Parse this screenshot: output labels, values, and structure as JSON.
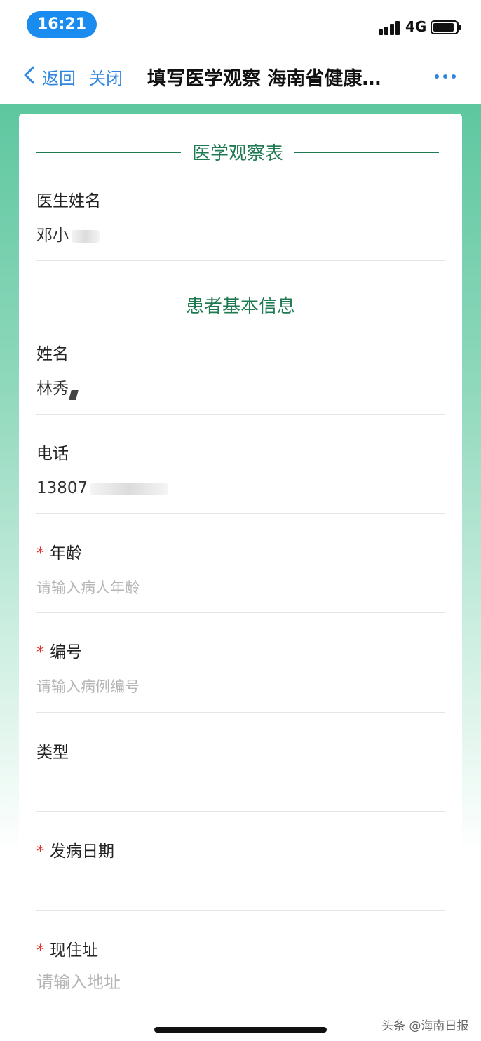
{
  "status_bar": {
    "time": "16:21",
    "network": "4G"
  },
  "nav": {
    "back_label": "返回",
    "close_label": "关闭",
    "title": "填写医学观察 海南省健康…"
  },
  "form": {
    "section_title": "医学观察表",
    "doctor_name": {
      "label": "医生姓名",
      "value": "邓小"
    },
    "patient_section_title": "患者基本信息",
    "name": {
      "label": "姓名",
      "value": "林秀"
    },
    "phone": {
      "label": "电话",
      "value": "13807"
    },
    "age": {
      "label": "年龄",
      "required_mark": "*",
      "placeholder": "请输入病人年龄"
    },
    "case_number": {
      "label": "编号",
      "required_mark": "*",
      "placeholder": "请输入病例编号"
    },
    "type": {
      "label": "类型",
      "value": ""
    },
    "onset_date": {
      "label": "发病日期",
      "required_mark": "*",
      "value": ""
    },
    "address": {
      "label": "现住址",
      "required_mark": "*",
      "placeholder": "请输入地址"
    }
  },
  "watermark": "头条 @海南日报",
  "colors": {
    "accent_blue": "#2f86e0",
    "section_green": "#1f7a52",
    "required_red": "#e0332f",
    "bg_green": "#5ec7a0"
  }
}
